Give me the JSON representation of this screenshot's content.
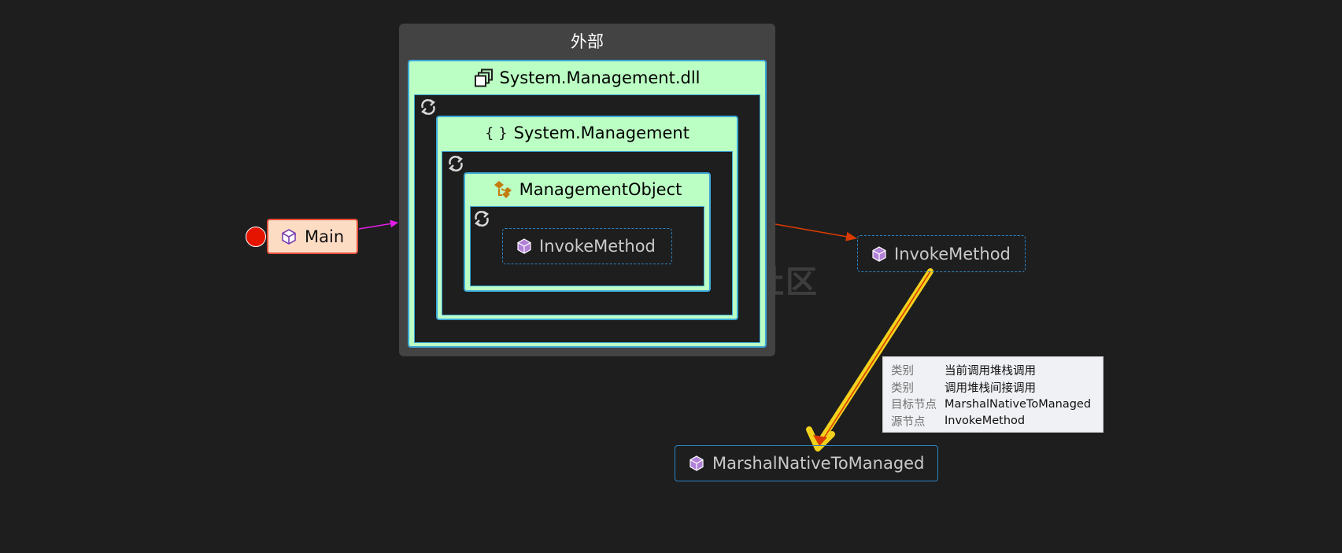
{
  "canvas": {
    "background": "#1e1e1e"
  },
  "external_group": {
    "title": "外部"
  },
  "assembly": {
    "label": "System.Management.dll"
  },
  "namespace_group": {
    "label": "System.Management"
  },
  "class_group": {
    "label": "ManagementObject"
  },
  "inner_method": {
    "label": "InvokeMethod"
  },
  "nodes": {
    "main": {
      "label": "Main",
      "breakpoint": true
    },
    "invoke_method": {
      "label": "InvokeMethod"
    },
    "marshal": {
      "label": "MarshalNativeToManaged"
    }
  },
  "tooltip": {
    "rows": [
      {
        "key": "类别",
        "value": "当前调用堆栈调用"
      },
      {
        "key": "类别",
        "value": "调用堆栈间接调用"
      },
      {
        "key": "目标节点",
        "value": "MarshalNativeToManaged"
      },
      {
        "key": "源节点",
        "value": "InvokeMethod"
      }
    ]
  },
  "watermark": {
    "text": "奇安信攻防社区"
  },
  "colors": {
    "group_bg": "#434343",
    "container_green": "#bcffc4",
    "container_border": "#3ba8d8",
    "method_border": "#2b84c4",
    "main_fill": "#fddcc4",
    "main_border": "#e3503a",
    "breakpoint": "#e51400",
    "edge_magenta": "#e21ee6",
    "edge_red": "#d83b01",
    "edge_highlight": "#f4d21c",
    "method_icon": "#b180d7"
  },
  "icons": {
    "assembly": "assembly-icon",
    "namespace": "namespace-braces-icon",
    "class": "class-icon",
    "method": "method-cube-icon",
    "refresh": "refresh-icon"
  }
}
